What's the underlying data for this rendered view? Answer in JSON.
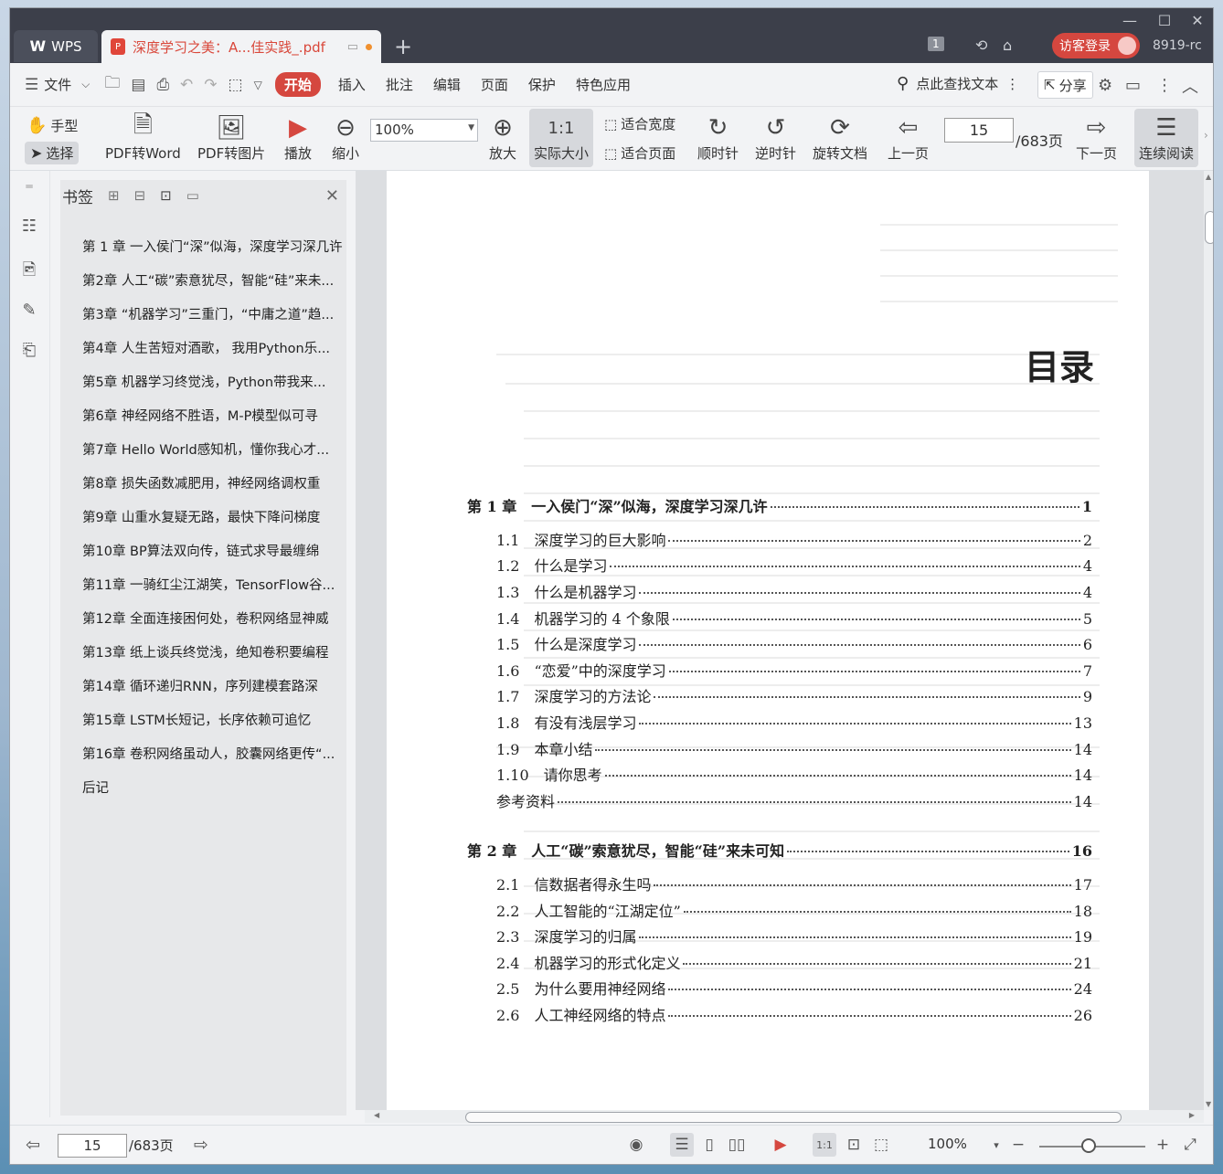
{
  "titlebar": {
    "app_tab": "WPS",
    "doc_tab": "深度学习之美：A...佳实践_.pdf",
    "count_badge": "1",
    "login": "访客登录",
    "user_short": "8919-rc"
  },
  "menu": {
    "file": "文件",
    "items": [
      "开始",
      "插入",
      "批注",
      "编辑",
      "页面",
      "保护",
      "特色应用"
    ],
    "search": "点此查找文本",
    "share": "分享"
  },
  "ribbon": {
    "hand": "手型",
    "select": "选择",
    "pdf_word": "PDF转Word",
    "pdf_img": "PDF转图片",
    "play": "播放",
    "zoom_out": "缩小",
    "zoom_value": "100%",
    "zoom_in": "放大",
    "actual_size": "实际大小",
    "fit_width": "适合宽度",
    "fit_page": "适合页面",
    "cw": "顺时针",
    "ccw": "逆时针",
    "rotate_doc": "旋转文档",
    "prev": "上一页",
    "page": "15",
    "page_total": "/683页",
    "next": "下一页",
    "continuous": "连续阅读"
  },
  "bookmarks": {
    "title": "书签",
    "items": [
      "第 1 章 一入侯门“深”似海，深度学习深几许",
      "第2章 人工“碳”索意犹尽，智能“硅”来未...",
      "第3章 “机器学习”三重门，“中庸之道”趋...",
      "第4章 人生苦短对酒歌， 我用Python乐...",
      "第5章 机器学习终觉浅，Python带我来...",
      "第6章 神经网络不胜语，M-P模型似可寻",
      "第7章 Hello World感知机，懂你我心才...",
      "第8章 损失函数减肥用，神经网络调权重",
      "第9章 山重水复疑无路，最快下降问梯度",
      "第10章 BP算法双向传，链式求导最缠绵",
      "第11章 一骑红尘江湖笑，TensorFlow谷...",
      "第12章 全面连接困何处，卷积网络显神威",
      "第13章 纸上谈兵终觉浅，绝知卷积要编程",
      "第14章 循环递归RNN，序列建模套路深",
      "第15章 LSTM长短记，长序依赖可追忆",
      "第16章 卷积网络虽动人，胶囊网络更传“...",
      "后记"
    ]
  },
  "toc": {
    "title": "目录",
    "rows": [
      {
        "label": "第 1 章　一入侯门“深”似海，深度学习深几许",
        "page": "1",
        "level": 0
      },
      {
        "label": "1.1　深度学习的巨大影响",
        "page": "2",
        "level": 1
      },
      {
        "label": "1.2　什么是学习",
        "page": "4",
        "level": 1
      },
      {
        "label": "1.3　什么是机器学习",
        "page": "4",
        "level": 1
      },
      {
        "label": "1.4　机器学习的 4 个象限",
        "page": "5",
        "level": 1
      },
      {
        "label": "1.5　什么是深度学习",
        "page": "6",
        "level": 1
      },
      {
        "label": "1.6　“恋爱”中的深度学习",
        "page": "7",
        "level": 1
      },
      {
        "label": "1.7　深度学习的方法论",
        "page": "9",
        "level": 1
      },
      {
        "label": "1.8　有没有浅层学习",
        "page": "13",
        "level": 1
      },
      {
        "label": "1.9　本章小结",
        "page": "14",
        "level": 1
      },
      {
        "label": "1.10　请你思考",
        "page": "14",
        "level": 1
      },
      {
        "label": "参考资料",
        "page": "14",
        "level": 1
      },
      {
        "label": "第 2 章　人工“碳”索意犹尽，智能“硅”来未可知",
        "page": "16",
        "level": 0
      },
      {
        "label": "2.1　信数据者得永生吗",
        "page": "17",
        "level": 1
      },
      {
        "label": "2.2　人工智能的“江湖定位”",
        "page": "18",
        "level": 1
      },
      {
        "label": "2.3　深度学习的归属",
        "page": "19",
        "level": 1
      },
      {
        "label": "2.4　机器学习的形式化定义",
        "page": "21",
        "level": 1
      },
      {
        "label": "2.5　为什么要用神经网络",
        "page": "24",
        "level": 1
      },
      {
        "label": "2.6　人工神经网络的特点",
        "page": "26",
        "level": 1
      }
    ]
  },
  "status": {
    "page": "15",
    "total": "/683页",
    "zoom": "100%"
  }
}
